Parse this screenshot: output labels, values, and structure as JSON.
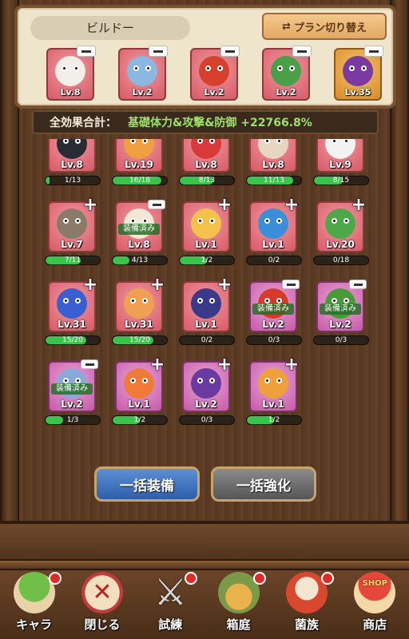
{
  "build_panel": {
    "name": "ビルドー",
    "plan_switch_label": "プラン切り替え",
    "plan_switch_icon": "swap-icon",
    "equipped": [
      {
        "level": "Lv.8",
        "color": "#e46a78",
        "creature": "white-deer"
      },
      {
        "level": "Lv.2",
        "color": "#e46a78",
        "creature": "blue-robot-bear"
      },
      {
        "level": "Lv.2",
        "color": "#e46a78",
        "creature": "red-dragon"
      },
      {
        "level": "Lv.2",
        "color": "#e46a78",
        "creature": "green-frog-redhat"
      },
      {
        "level": "Lv.35",
        "color": "#e0a040",
        "creature": "purple-eggplant-sunglasses"
      }
    ]
  },
  "effect": {
    "label": "全効果合計：",
    "value": "基礎体力&攻撃&防御 +22766.8%"
  },
  "collection": [
    {
      "level": "Lv.8",
      "progress": "1/13",
      "fraction": 0.077,
      "sign": "",
      "equipped_badge": "",
      "tint": "pink",
      "body": "#2b2b33"
    },
    {
      "level": "Lv.19",
      "progress": "16/18",
      "fraction": 0.889,
      "sign": "",
      "equipped_badge": "",
      "tint": "pink",
      "body": "#f0a040"
    },
    {
      "level": "Lv.8",
      "progress": "8/13",
      "fraction": 0.615,
      "sign": "",
      "equipped_badge": "",
      "tint": "pink",
      "body": "#d83a3a"
    },
    {
      "level": "Lv.8",
      "progress": "11/13",
      "fraction": 0.846,
      "sign": "",
      "equipped_badge": "",
      "tint": "pink",
      "body": "#e8d7c0"
    },
    {
      "level": "Lv.9",
      "progress": "8/15",
      "fraction": 0.533,
      "sign": "",
      "equipped_badge": "",
      "tint": "pink",
      "body": "#f2f2f2"
    },
    {
      "level": "Lv.7",
      "progress": "7/11",
      "fraction": 0.636,
      "sign": "+",
      "equipped_badge": "",
      "tint": "pink",
      "body": "#8a7a68"
    },
    {
      "level": "Lv.8",
      "progress": "4/13",
      "fraction": 0.308,
      "sign": "-",
      "equipped_badge": "装備済み",
      "tint": "pink",
      "body": "#f3e7d5"
    },
    {
      "level": "Lv.1",
      "progress": "1/2",
      "fraction": 0.5,
      "sign": "+",
      "equipped_badge": "",
      "tint": "pink",
      "body": "#f4c24a"
    },
    {
      "level": "Lv.1",
      "progress": "0/2",
      "fraction": 0.0,
      "sign": "+",
      "equipped_badge": "",
      "tint": "pink",
      "body": "#3a8fd8"
    },
    {
      "level": "Lv.20",
      "progress": "0/18",
      "fraction": 0.0,
      "sign": "+",
      "equipped_badge": "",
      "tint": "pink",
      "body": "#4da84a"
    },
    {
      "level": "Lv.31",
      "progress": "15/20",
      "fraction": 0.75,
      "sign": "+",
      "equipped_badge": "",
      "tint": "pink",
      "body": "#3a5fd0"
    },
    {
      "level": "Lv.31",
      "progress": "15/20",
      "fraction": 0.75,
      "sign": "+",
      "equipped_badge": "",
      "tint": "pink",
      "body": "#f0a050"
    },
    {
      "level": "Lv.1",
      "progress": "0/2",
      "fraction": 0.0,
      "sign": "+",
      "equipped_badge": "",
      "tint": "pink",
      "body": "#3a3a8a"
    },
    {
      "level": "Lv.2",
      "progress": "0/3",
      "fraction": 0.0,
      "sign": "-",
      "equipped_badge": "装備済み",
      "tint": "purple",
      "body": "#d83a2a"
    },
    {
      "level": "Lv.2",
      "progress": "0/3",
      "fraction": 0.0,
      "sign": "-",
      "equipped_badge": "装備済み",
      "tint": "purple",
      "body": "#4a9a3a"
    },
    {
      "level": "Lv.2",
      "progress": "1/3",
      "fraction": 0.333,
      "sign": "-",
      "equipped_badge": "装備済み",
      "tint": "purple",
      "body": "#8aa8d8"
    },
    {
      "level": "Lv.1",
      "progress": "1/2",
      "fraction": 0.5,
      "sign": "+",
      "equipped_badge": "",
      "tint": "purple",
      "body": "#f07a3a"
    },
    {
      "level": "Lv.2",
      "progress": "0/3",
      "fraction": 0.0,
      "sign": "+",
      "equipped_badge": "",
      "tint": "purple",
      "body": "#6a3aa0"
    },
    {
      "level": "Lv.1",
      "progress": "1/2",
      "fraction": 0.5,
      "sign": "+",
      "equipped_badge": "",
      "tint": "purple",
      "body": "#f0a03a"
    }
  ],
  "actions": {
    "bulk_equip": "一括装備",
    "bulk_upgrade": "一括強化"
  },
  "nav": [
    {
      "label": "キャラ",
      "icon": "mushroom-character-icon",
      "cls": "mush",
      "notify": true
    },
    {
      "label": "閉じる",
      "icon": "close-icon",
      "cls": "close-ic",
      "notify": false
    },
    {
      "label": "試練",
      "icon": "crossed-swords-icon",
      "cls": "sword-ic",
      "notify": true
    },
    {
      "label": "箱庭",
      "icon": "garden-pot-icon",
      "cls": "garden-ic",
      "notify": true
    },
    {
      "label": "菌族",
      "icon": "clan-skull-icon",
      "cls": "clan-ic",
      "notify": true
    },
    {
      "label": "商店",
      "icon": "shop-icon",
      "cls": "shop-ic",
      "notify": false
    }
  ]
}
